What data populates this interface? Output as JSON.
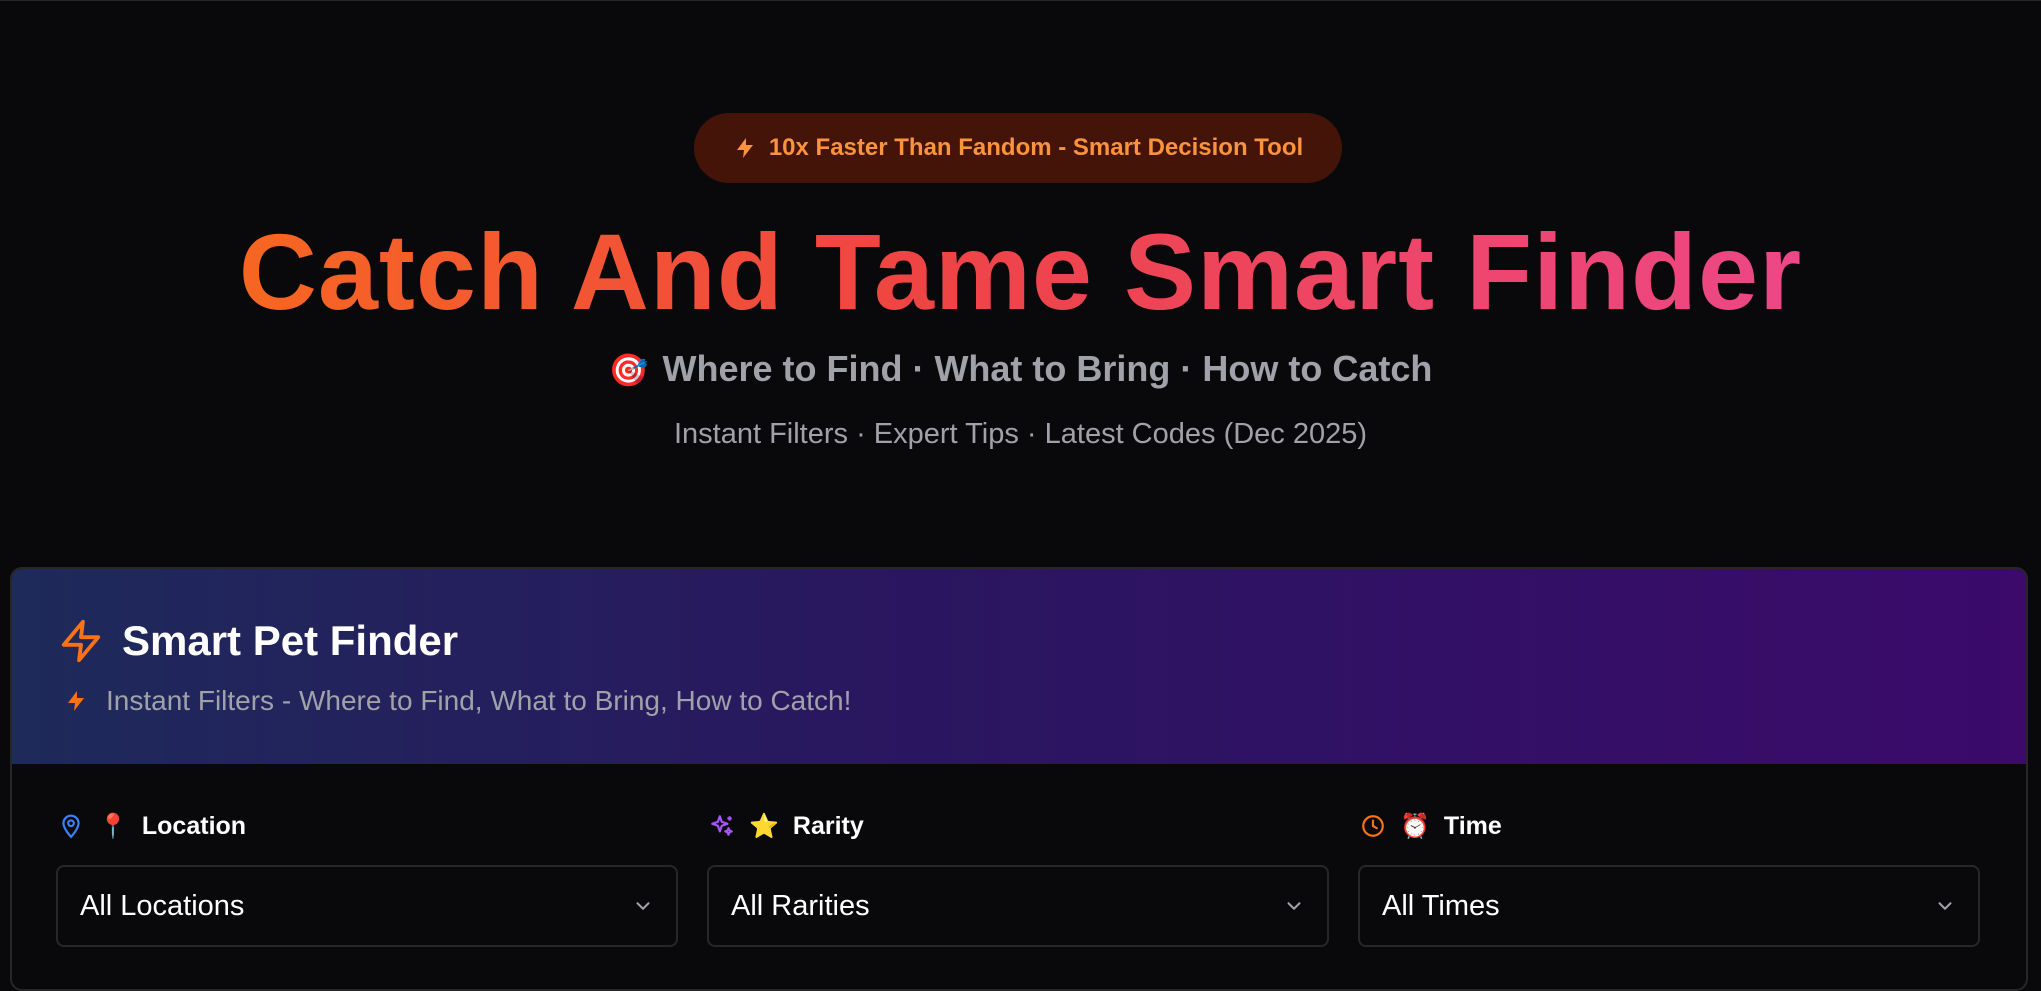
{
  "hero": {
    "badge": "10x Faster Than Fandom - Smart Decision Tool",
    "title": "Catch And Tame Smart Finder",
    "subtitle_emoji": "🎯",
    "subtitle": "Where to Find · What to Bring · How to Catch",
    "tagline": "Instant Filters · Expert Tips · Latest Codes (Dec 2025)"
  },
  "finder": {
    "title": "Smart Pet Finder",
    "description": "Instant Filters - Where to Find, What to Bring, How to Catch!",
    "filters": [
      {
        "emoji": "📍",
        "label": "Location",
        "value": "All Locations",
        "icon": "map-pin-icon",
        "icon_color": "#3b82f6"
      },
      {
        "emoji": "⭐",
        "label": "Rarity",
        "value": "All Rarities",
        "icon": "sparkles-icon",
        "icon_color": "#a855f7"
      },
      {
        "emoji": "⏰",
        "label": "Time",
        "value": "All Times",
        "icon": "clock-icon",
        "icon_color": "#f97316"
      }
    ]
  },
  "colors": {
    "accent_orange": "#f97316",
    "accent_pink": "#ec4899",
    "background": "#09090b"
  }
}
